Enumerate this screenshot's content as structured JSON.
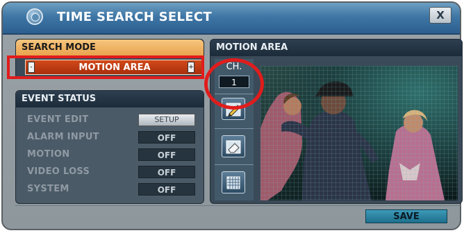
{
  "window": {
    "title": "TIME SEARCH SELECT",
    "close_label": "X"
  },
  "search_mode": {
    "header": "SEARCH MODE",
    "value": "MOTION AREA",
    "spin_left": "-",
    "spin_right": "+"
  },
  "event_status": {
    "header": "EVENT STATUS",
    "rows": [
      {
        "label": "EVENT EDIT",
        "value": "SETUP"
      },
      {
        "label": "ALARM INPUT",
        "value": "OFF"
      },
      {
        "label": "MOTION",
        "value": "OFF"
      },
      {
        "label": "VIDEO LOSS",
        "value": "OFF"
      },
      {
        "label": "SYSTEM",
        "value": "OFF"
      }
    ]
  },
  "motion_area": {
    "header": "MOTION AREA",
    "ch_label": "CH.",
    "ch_value": "1",
    "tools": [
      "pencil-icon",
      "eraser-icon",
      "grid-icon"
    ]
  },
  "footer": {
    "save_label": "SAVE"
  },
  "colors": {
    "accent_orange": "#e8a24c",
    "select_red": "#c23e14",
    "highlight_red": "#e11c1c",
    "save_blue": "#2a86a6"
  }
}
